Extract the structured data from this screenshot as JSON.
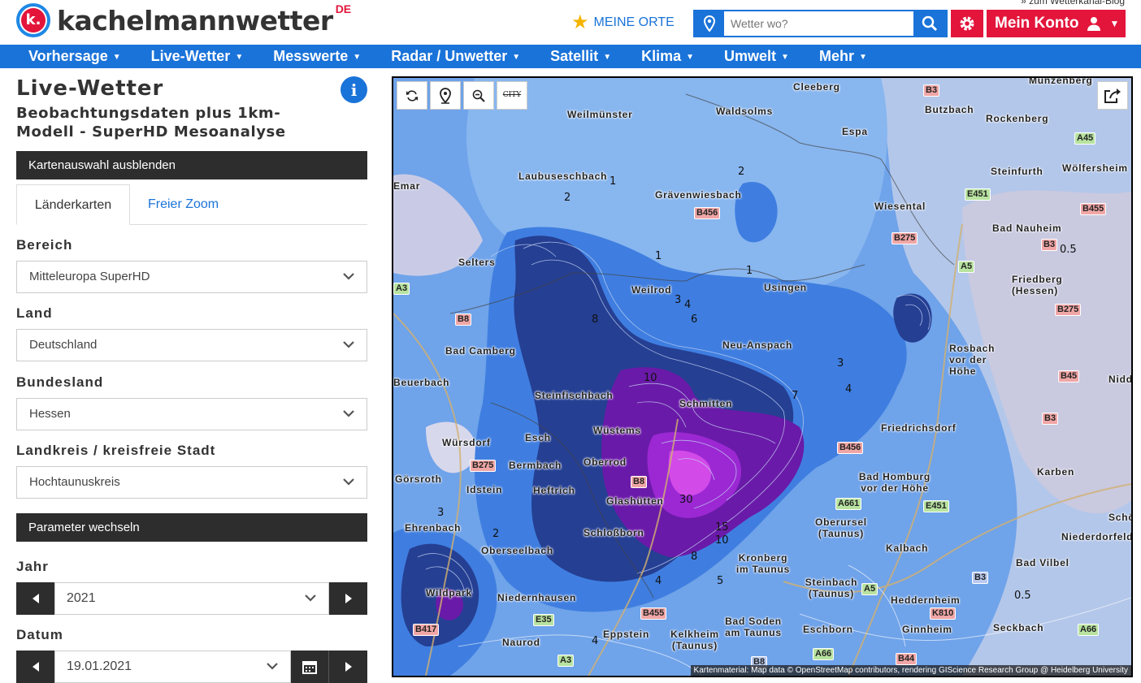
{
  "header": {
    "logo_mark": "k.",
    "logo_text": "kachelmannwetter",
    "logo_country": "DE",
    "blog_link": "» zum Wetterkanal-Blog",
    "meine_orte": "MEINE ORTE",
    "search_placeholder": "Wetter wo?",
    "account_label": "Mein Konto"
  },
  "nav": {
    "items": [
      "Vorhersage",
      "Live-Wetter",
      "Messwerte",
      "Radar / Unwetter",
      "Satellit",
      "Klima",
      "Umwelt",
      "Mehr"
    ]
  },
  "sidebar": {
    "title": "Live-Wetter",
    "subtitle": "Beobachtungsdaten plus 1km-Modell - SuperHD Mesoanalyse",
    "toggle_map_selection": "Kartenauswahl ausblenden",
    "tabs": [
      "Länderkarten",
      "Freier Zoom"
    ],
    "fields": {
      "bereich": {
        "label": "Bereich",
        "value": "Mitteleuropa SuperHD"
      },
      "land": {
        "label": "Land",
        "value": "Deutschland"
      },
      "bundesland": {
        "label": "Bundesland",
        "value": "Hessen"
      },
      "landkreis": {
        "label": "Landkreis / kreisfreie Stadt",
        "value": "Hochtaunuskreis"
      }
    },
    "parameter_bar": "Parameter wechseln",
    "jahr": {
      "label": "Jahr",
      "value": "2021"
    },
    "datum": {
      "label": "Datum",
      "value": "19.01.2021"
    }
  },
  "map": {
    "city_toggle": "CITY",
    "attribution": "Kartenmaterial: Map data © OpenStreetMap contributors, rendering GIScience Research Group @ Heidelberg University",
    "places": [
      "Cleeberg",
      "Weilmünster",
      "Waldsolms",
      "Espa",
      "Butzbach",
      "Rockenberg",
      "Laubuseschbach",
      "Grävenwiesbach",
      "Steinfurth",
      "Wölfersheim",
      "Wiesental",
      "Bad Nauheim",
      "Selters",
      "Weilrod",
      "Usingen",
      "Friedberg (Hessen)",
      "Bad Camberg",
      "Neu-Anspach",
      "Rosbach vor der Höhe",
      "Beuerbach",
      "Steinfischbach",
      "Schmitten",
      "Friedrichsdorf",
      "Wüstems",
      "Würsdorf",
      "Esch",
      "Oberrod",
      "Görsroth",
      "Bermbach",
      "Idstein",
      "Heftrich",
      "Glashütten",
      "Bad Homburg vor der Höhe",
      "Karben",
      "Ehrenbach",
      "Oberseelbach",
      "Schloßborn",
      "Oberursel (Taunus)",
      "Kalbach",
      "Niederdorfelden",
      "Schöneck",
      "Kronberg im Taunus",
      "Bad Vilbel",
      "Wildpark",
      "Niedernhausen",
      "Steinbach (Taunus)",
      "Heddernheim",
      "Bad Soden am Taunus",
      "Eschborn",
      "Ginnheim",
      "Seckbach",
      "Eppstein",
      "Kelkheim (Taunus)",
      "Naurod",
      "Nidda",
      "Münzenberg",
      "Emar"
    ],
    "roads": [
      "B3",
      "A45",
      "B455",
      "E451",
      "B456",
      "B275",
      "A5",
      "A3",
      "B8",
      "B45",
      "B275",
      "B3",
      "B456",
      "E451",
      "A661",
      "A5",
      "B3",
      "K810",
      "A66",
      "B417",
      "E35",
      "B455",
      "A3",
      "B8",
      "A66",
      "B44",
      "B275",
      "B8",
      "B3"
    ],
    "isolines": [
      "1",
      "2",
      "1",
      "2",
      "1",
      "2",
      "3",
      "4",
      "8",
      "6",
      "3",
      "4",
      "10",
      "7",
      "30",
      "15",
      "10",
      "5",
      "5",
      "8",
      "4",
      "3",
      "2",
      "3",
      "0.5",
      "0.5",
      "4",
      "4"
    ]
  },
  "colors": {
    "accent_blue": "#1a73d9",
    "brand_red": "#e3153b",
    "dark_bar": "#2d2d2d"
  }
}
